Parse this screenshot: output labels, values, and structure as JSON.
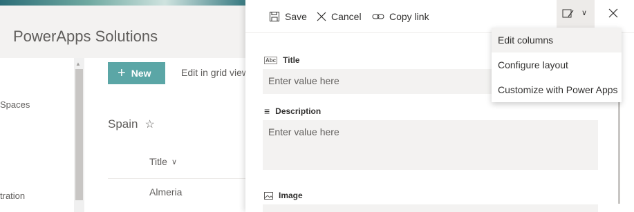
{
  "site": {
    "title": "PowerApps Solutions"
  },
  "leftnav": {
    "items": [
      {
        "label": "Spaces"
      },
      {
        "label": "tration"
      }
    ]
  },
  "commandbar": {
    "new_label": "New",
    "grid_label": "Edit in grid view"
  },
  "list": {
    "name": "Spain",
    "columns": [
      {
        "label": "Title"
      }
    ],
    "rows": [
      {
        "title": "Almeria"
      }
    ]
  },
  "panel": {
    "commands": {
      "save": "Save",
      "cancel": "Cancel",
      "copy_link": "Copy link"
    },
    "fields": [
      {
        "label": "Title",
        "placeholder": "Enter value here",
        "icon": "text-field-icon"
      },
      {
        "label": "Description",
        "placeholder": "Enter value here",
        "icon": "multiline-text-icon"
      },
      {
        "label": "Image",
        "icon": "image-icon"
      }
    ]
  },
  "dropdown": {
    "items": [
      {
        "label": "Edit columns",
        "active": true
      },
      {
        "label": "Configure layout"
      },
      {
        "label": "Customize with Power Apps"
      }
    ]
  },
  "colors": {
    "accent": "#5ba6a6",
    "panel_bg": "#ffffff",
    "input_bg": "#f3f2f1"
  }
}
